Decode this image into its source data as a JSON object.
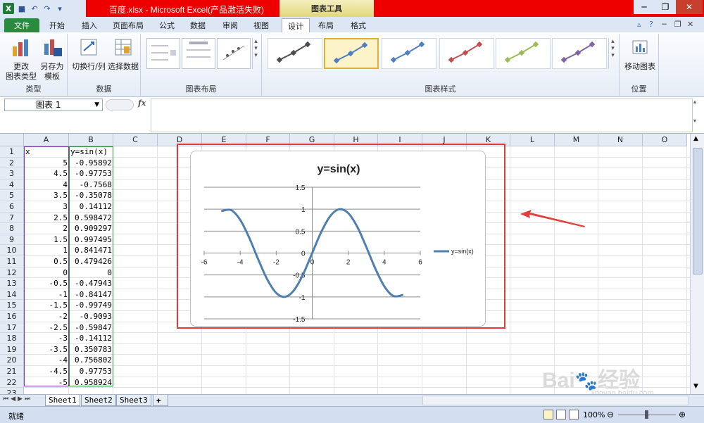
{
  "window": {
    "title": "百度.xlsx  -  Microsoft Excel(产品激活失败)",
    "chart_tools_label": "图表工具"
  },
  "tabs": [
    {
      "label": "文件"
    },
    {
      "label": "开始"
    },
    {
      "label": "插入"
    },
    {
      "label": "页面布局"
    },
    {
      "label": "公式"
    },
    {
      "label": "数据"
    },
    {
      "label": "审阅"
    },
    {
      "label": "视图"
    },
    {
      "label": "设计"
    },
    {
      "label": "布局"
    },
    {
      "label": "格式"
    }
  ],
  "ribbon": {
    "type_group": {
      "label": "类型",
      "change_type": "更改\n图表类型",
      "save_template": "另存为\n模板"
    },
    "data_group": {
      "label": "数据",
      "switch_row_col": "切换行/列",
      "select_data": "选择数据"
    },
    "layout_group": {
      "label": "图表布局"
    },
    "styles_group": {
      "label": "图表样式",
      "styles": [
        "#4d4d4d",
        "#4f7fc0",
        "#4f7fc0",
        "#c0504d",
        "#9bbb59",
        "#8064a2"
      ]
    },
    "location_group": {
      "label": "位置",
      "move_chart": "移动图表"
    }
  },
  "formula_bar": {
    "name_box": "图表 1",
    "fx": "fx"
  },
  "columns": [
    "A",
    "B",
    "C",
    "D",
    "E",
    "F",
    "G",
    "H",
    "I",
    "J",
    "K",
    "L",
    "M",
    "N",
    "O"
  ],
  "rows": [
    "1",
    "2",
    "3",
    "4",
    "5",
    "6",
    "7",
    "8",
    "9",
    "10",
    "11",
    "12",
    "13",
    "14",
    "15",
    "16",
    "17",
    "18",
    "19",
    "20",
    "21",
    "22",
    "23"
  ],
  "table": {
    "header": [
      "x",
      "y=sin(x)"
    ],
    "rows": [
      [
        "5",
        "-0.95892"
      ],
      [
        "4.5",
        "-0.97753"
      ],
      [
        "4",
        "-0.7568"
      ],
      [
        "3.5",
        "-0.35078"
      ],
      [
        "3",
        "0.14112"
      ],
      [
        "2.5",
        "0.598472"
      ],
      [
        "2",
        "0.909297"
      ],
      [
        "1.5",
        "0.997495"
      ],
      [
        "1",
        "0.841471"
      ],
      [
        "0.5",
        "0.479426"
      ],
      [
        "0",
        "0"
      ],
      [
        "-0.5",
        "-0.47943"
      ],
      [
        "-1",
        "-0.84147"
      ],
      [
        "-1.5",
        "-0.99749"
      ],
      [
        "-2",
        "-0.9093"
      ],
      [
        "-2.5",
        "-0.59847"
      ],
      [
        "-3",
        "-0.14112"
      ],
      [
        "-3.5",
        "0.350783"
      ],
      [
        "-4",
        "0.756802"
      ],
      [
        "-4.5",
        "0.97753"
      ],
      [
        "-5",
        "0.958924"
      ]
    ]
  },
  "sheets": [
    "Sheet1",
    "Sheet2",
    "Sheet3"
  ],
  "status": {
    "ready": "就绪",
    "zoom": "100%"
  },
  "watermark": {
    "text": "jingyan.baidu.com"
  },
  "colors": {
    "accent_red": "#e00000",
    "series": "#4f7fb0"
  },
  "chart_data": {
    "type": "scatter",
    "title": "y=sin(x)",
    "series": [
      {
        "name": "y=sin(x)",
        "x": [
          5,
          4.5,
          4,
          3.5,
          3,
          2.5,
          2,
          1.5,
          1,
          0.5,
          0,
          -0.5,
          -1,
          -1.5,
          -2,
          -2.5,
          -3,
          -3.5,
          -4,
          -4.5,
          -5
        ],
        "y": [
          -0.95892,
          -0.97753,
          -0.7568,
          -0.35078,
          0.14112,
          0.598472,
          0.909297,
          0.997495,
          0.841471,
          0.479426,
          0,
          -0.47943,
          -0.84147,
          -0.99749,
          -0.9093,
          -0.59847,
          -0.14112,
          0.350783,
          0.756802,
          0.97753,
          0.958924
        ]
      }
    ],
    "xlim": [
      -6,
      6
    ],
    "ylim": [
      -1.5,
      1.5
    ],
    "xticks": [
      "-6",
      "-4",
      "-2",
      "0",
      "2",
      "4",
      "6"
    ],
    "yticks": [
      "1.5",
      "1",
      "0.5",
      "0",
      "-0.5",
      "-1",
      "-1.5"
    ],
    "grid": "horizontal",
    "legend": "right"
  }
}
